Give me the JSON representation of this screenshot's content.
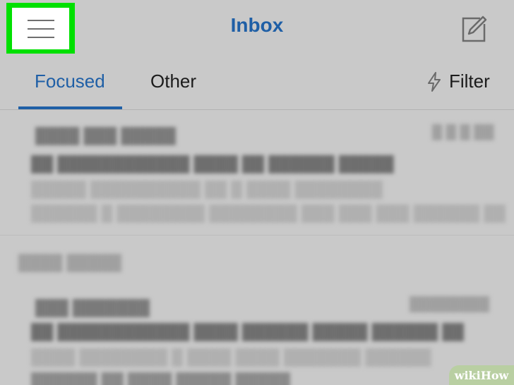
{
  "header": {
    "title": "Inbox",
    "menu_icon": "hamburger-menu-icon",
    "compose_icon": "compose-icon",
    "highlight_color": "#00e000"
  },
  "tabs": [
    {
      "label": "Focused",
      "active": true
    },
    {
      "label": "Other",
      "active": false
    }
  ],
  "filter": {
    "label": "Filter",
    "icon": "lightning-bolt-icon"
  },
  "colors": {
    "accent": "#1f5fa6",
    "background": "#c9c9c9"
  },
  "watermark": {
    "part1": "wiki",
    "part2": "How"
  }
}
